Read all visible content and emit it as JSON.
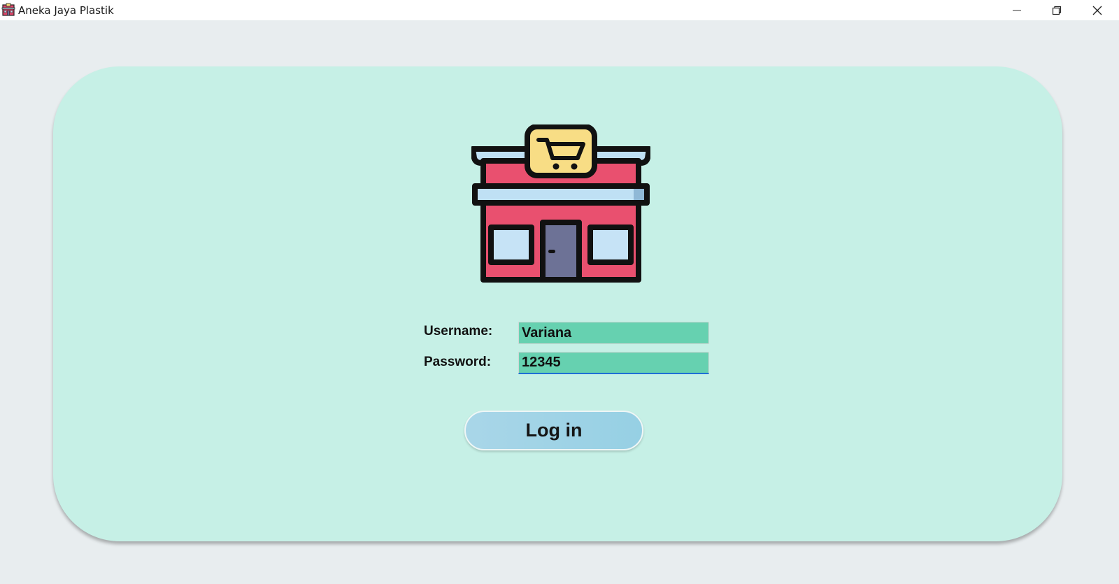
{
  "window": {
    "title": "Aneka Jaya Plastik",
    "controls": [
      "minimize-icon",
      "restore-icon",
      "close-icon"
    ]
  },
  "login": {
    "logo_icon": "store-icon",
    "username_label": "Username:",
    "username_value": "Variana",
    "password_label": "Password:",
    "password_value": "12345",
    "submit_label": "Log in"
  },
  "colors": {
    "background": "#e8edef",
    "card": "#c6f0e6",
    "field": "#66d1b0",
    "button": "#a3d4e6",
    "focus_underline": "#1f6fd6"
  }
}
